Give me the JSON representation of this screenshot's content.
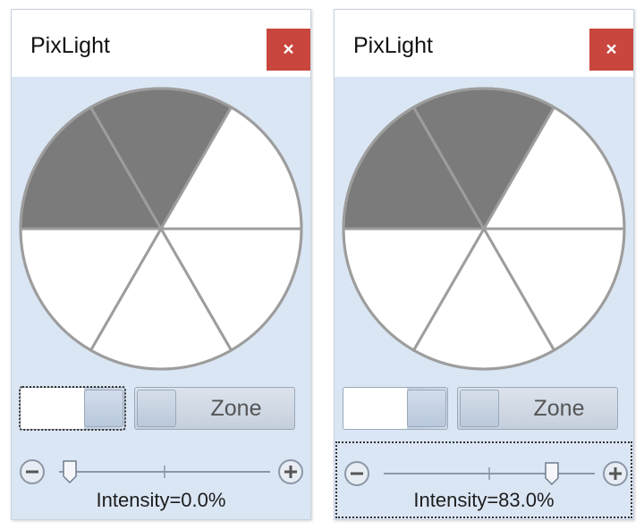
{
  "windows": [
    {
      "title": "PixLight",
      "close_label": "×",
      "zone_label": "Zone",
      "intensity_text": "Intensity=0.0%",
      "intensity_percent": 0.0,
      "wheel_segments": [
        "dark",
        "dark",
        "light",
        "light",
        "light",
        "light"
      ],
      "mode_button_focused": true,
      "slider_focused": false,
      "slider_minus_label": "−",
      "slider_plus_label": "+"
    },
    {
      "title": "PixLight",
      "close_label": "×",
      "zone_label": "Zone",
      "intensity_text": "Intensity=83.0%",
      "intensity_percent": 83.0,
      "wheel_segments": [
        "dark",
        "dark",
        "light",
        "light",
        "light",
        "light"
      ],
      "mode_button_focused": false,
      "slider_focused": true,
      "slider_minus_label": "−",
      "slider_plus_label": "+"
    }
  ],
  "colors": {
    "segment_dark": "#7b7b7b",
    "segment_light": "#ffffff",
    "segment_stroke": "#9d9d9d",
    "close_button": "#c8463d",
    "panel_background": "#dbe6f4"
  }
}
